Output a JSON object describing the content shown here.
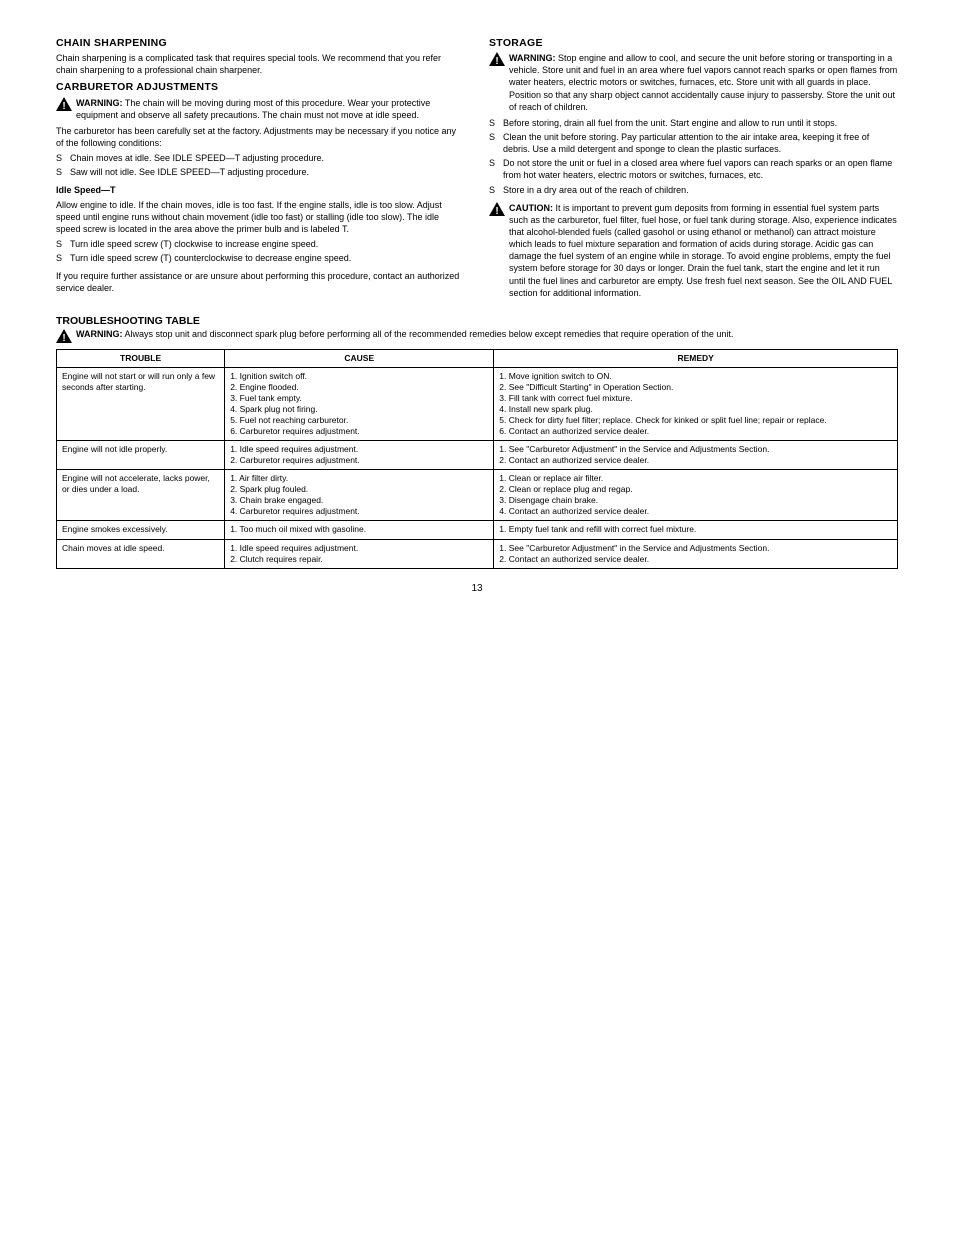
{
  "left": {
    "h1": "CHAIN SHARPENING",
    "p1": "Chain sharpening is a complicated task that requires special tools. We recommend that you refer chain sharpening to a professional chain sharpener.",
    "h2": "CARBURETOR ADJUSTMENTS",
    "warn1_label": "WARNING:",
    "warn1_text": " The chain will be moving during most of this procedure. Wear your protective equipment and observe all safety precautions. The chain must not move at idle speed.",
    "p2": "The carburetor has been carefully set at the factory. Adjustments may be necessary if you notice any of the following conditions:",
    "b1": "Chain moves at idle. See IDLE SPEED—T adjusting procedure.",
    "b2": "Saw will not idle. See IDLE SPEED—T adjusting procedure.",
    "sub1": "Idle Speed—T",
    "p3": "Allow engine to idle. If the chain moves, idle is too fast. If the engine stalls, idle is too slow. Adjust speed until engine runs without chain movement (idle too fast) or stalling (idle too slow). The idle speed screw is located in the area above the primer bulb and is labeled T.",
    "b3": "Turn idle speed screw (T) clockwise to increase engine speed.",
    "b4": "Turn idle speed screw (T) counterclockwise to decrease engine speed.",
    "p4": "If you require further assistance or are unsure about performing this procedure, contact an authorized service dealer."
  },
  "right": {
    "h1": "STORAGE",
    "warn1_label": "WARNING:",
    "warn1_text": " Stop engine and allow to cool, and secure the unit before storing or transporting in a vehicle. Store unit and fuel in an area where fuel vapors cannot reach sparks or open flames from water heaters, electric motors or switches, furnaces, etc. Store unit with all guards in place. Position so that any sharp object cannot accidentally cause injury to passersby. Store the unit out of reach of children.",
    "b1": "Before storing, drain all fuel from the unit. Start engine and allow to run until it stops.",
    "b2": "Clean the unit before storing. Pay particular attention to the air intake area, keeping it free of debris. Use a mild detergent and sponge to clean the plastic surfaces.",
    "b3": "Do not store the unit or fuel in a closed area where fuel vapors can reach sparks or an open flame from hot water heaters, electric motors or switches, furnaces, etc.",
    "b4": "Store in a dry area out of the reach of children.",
    "warn2_label": "CAUTION:",
    "warn2_text": " It is important to prevent gum deposits from forming in essential fuel system parts such as the carburetor, fuel filter, fuel hose, or fuel tank during storage. Also, experience indicates that alcohol-blended fuels (called gasohol or using ethanol or methanol) can attract moisture which leads to fuel mixture separation and formation of acids during storage. Acidic gas can damage the fuel system of an engine while in storage. To avoid engine problems, empty the fuel system before storage for 30 days or longer. Drain the fuel tank, start the engine and let it run until the fuel lines and carburetor are empty. Use fresh fuel next season. See the OIL AND FUEL section for additional information."
  },
  "trouble": {
    "h1": "TROUBLESHOOTING TABLE",
    "warn_label": "WARNING:",
    "warn_text": " Always stop unit and disconnect spark plug before performing all of the recommended remedies below except remedies that require operation of the unit.",
    "headers": [
      "TROUBLE",
      "CAUSE",
      "REMEDY"
    ],
    "rows": [
      {
        "t": "Engine will not start or will run only a few seconds after starting.",
        "c": [
          "1. Ignition switch off.",
          "2. Engine flooded.",
          "3. Fuel tank empty.",
          "4. Spark plug not firing.",
          "5. Fuel not reaching carburetor.",
          "6. Carburetor requires adjustment."
        ],
        "r": [
          "1. Move ignition switch to ON.",
          "2. See \"Difficult Starting\" in Operation Section.",
          "3. Fill tank with correct fuel mixture.",
          "4. Install new spark plug.",
          "5. Check for dirty fuel filter; replace. Check for kinked or split fuel line; repair or replace.",
          "6. Contact an authorized service dealer."
        ]
      },
      {
        "t": "Engine will not idle properly.",
        "c": [
          "1. Idle speed requires adjustment.",
          "2. Carburetor requires adjustment."
        ],
        "r": [
          "1. See \"Carburetor Adjustment\" in the Service and Adjustments Section.",
          "2. Contact an authorized service dealer."
        ]
      },
      {
        "t": "Engine will not accelerate, lacks power, or dies under a load.",
        "c": [
          "1. Air filter dirty.",
          "2. Spark plug fouled.",
          "3. Chain brake engaged.",
          "4. Carburetor requires adjustment."
        ],
        "r": [
          "1. Clean or replace air filter.",
          "2. Clean or replace plug and regap.",
          "3. Disengage chain brake.",
          "4. Contact an authorized service dealer."
        ]
      },
      {
        "t": "Engine smokes excessively.",
        "c": [
          "1. Too much oil mixed with gasoline."
        ],
        "r": [
          "1. Empty fuel tank and refill with correct fuel mixture."
        ]
      },
      {
        "t": "Chain moves at idle speed.",
        "c": [
          "1. Idle speed requires adjustment.",
          "2. Clutch requires repair."
        ],
        "r": [
          "1. See \"Carburetor Adjustment\" in the Service and Adjustments Section.",
          "2. Contact an authorized service dealer."
        ]
      }
    ]
  },
  "pageNumber": "13"
}
